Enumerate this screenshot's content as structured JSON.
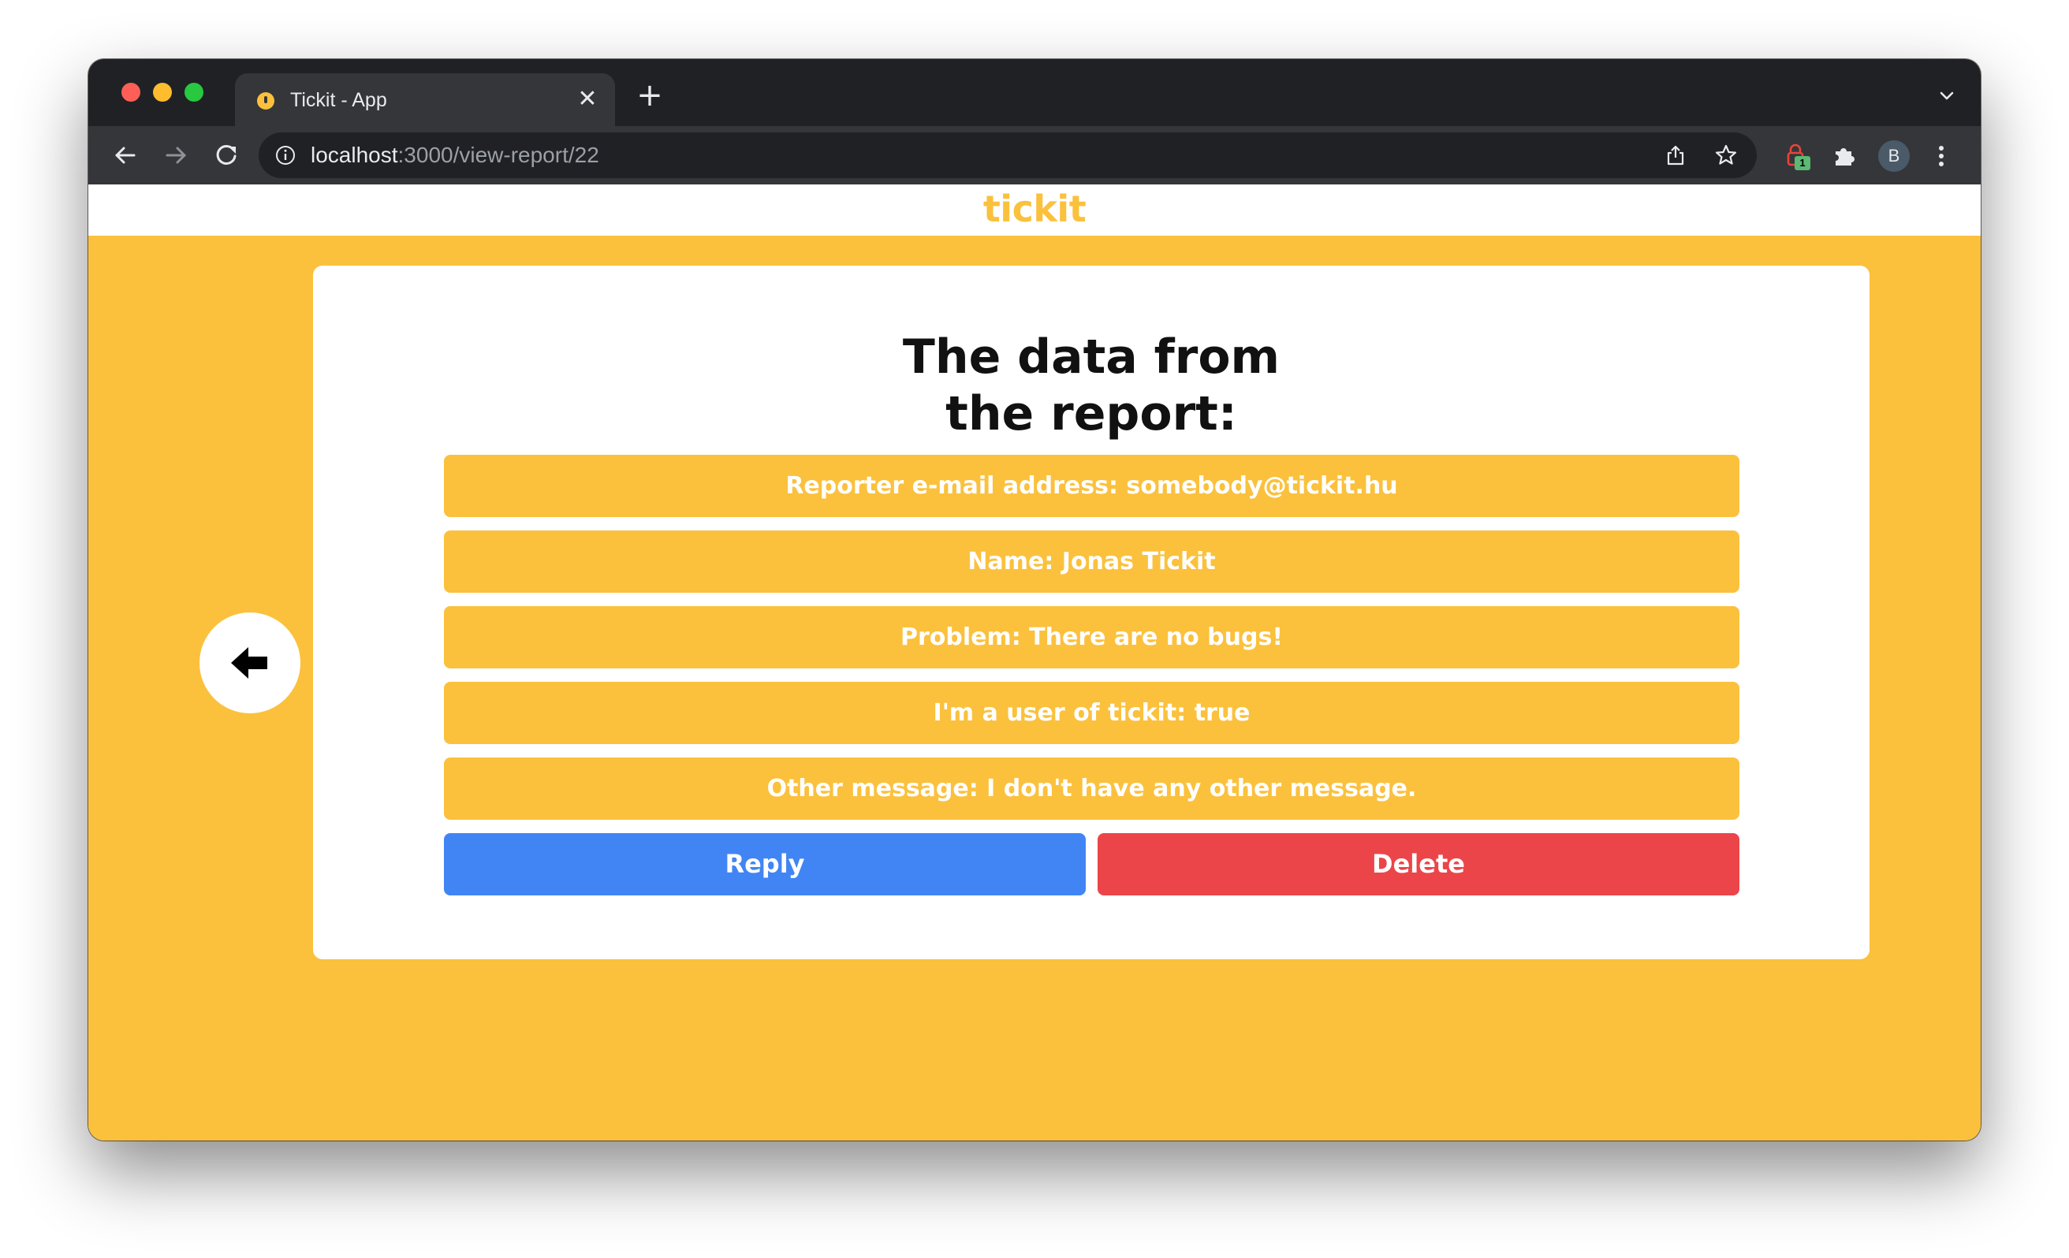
{
  "browser": {
    "tab": {
      "title": "Tickit - App",
      "close_icon": "close-icon",
      "favicon": "tickit-favicon"
    },
    "new_tab_icon": "plus-icon",
    "address": {
      "host": "localhost",
      "path": ":3000/view-report/22"
    },
    "extension_badge": "1",
    "profile_initial": "B"
  },
  "page": {
    "brand": "tickit",
    "title_line1": "The data from",
    "title_line2": "the report:",
    "fields": [
      "Reporter e-mail address: somebody@tickit.hu",
      "Name: Jonas Tickit",
      "Problem: There are no bugs!",
      "I'm a user of tickit: true",
      "Other message: I don't have any other message."
    ],
    "reply_label": "Reply",
    "delete_label": "Delete",
    "back_icon": "arrow-left-icon"
  },
  "colors": {
    "accent": "#fbc13d",
    "reply": "#4185f4",
    "delete": "#ec4549"
  }
}
